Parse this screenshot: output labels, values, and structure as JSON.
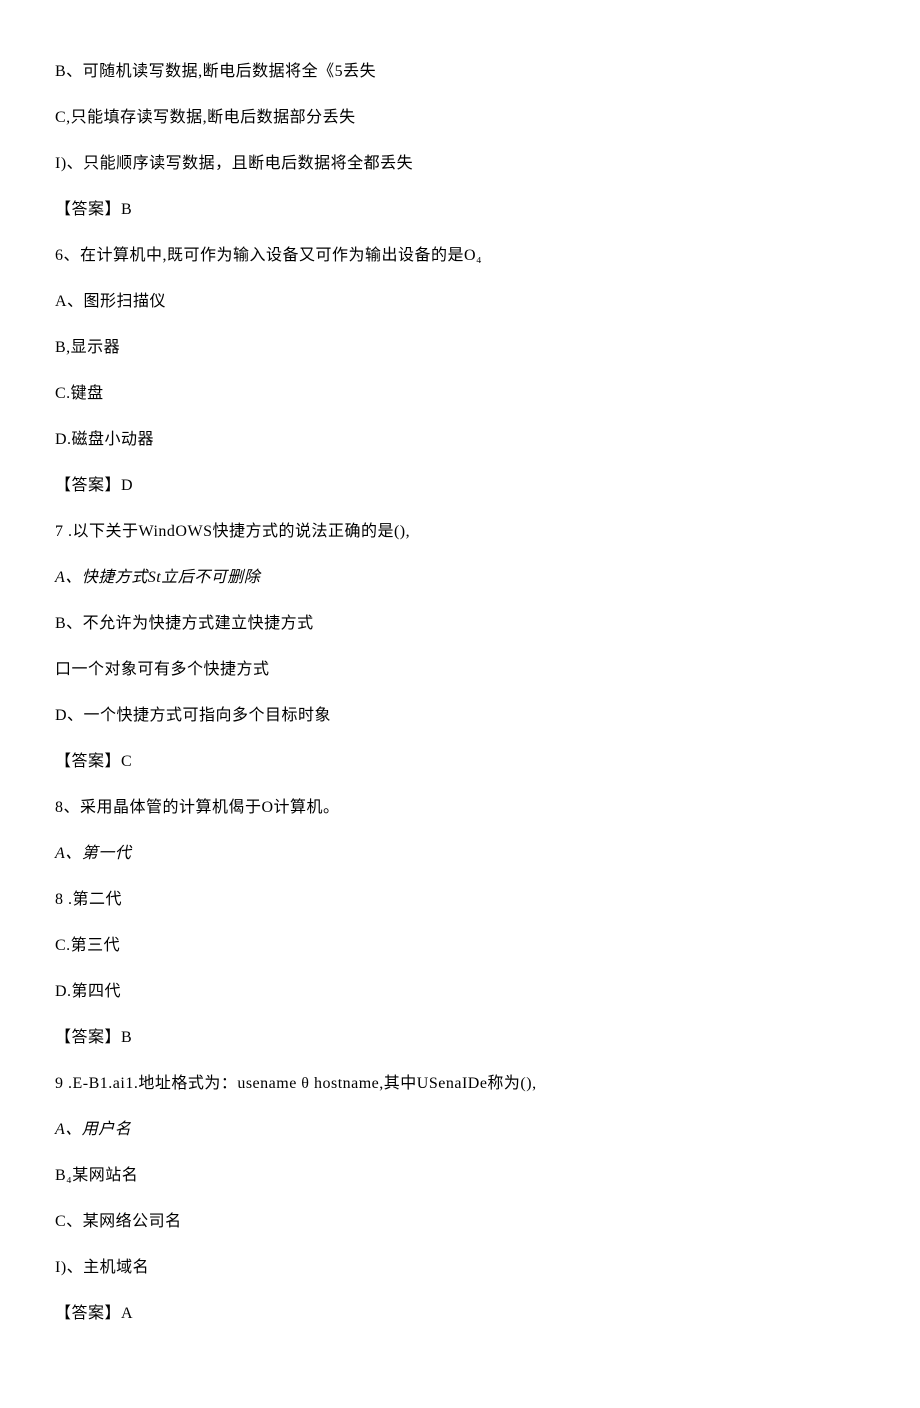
{
  "lines": [
    {
      "text": "B、可随机读写数据,断电后数据将全《5丢失"
    },
    {
      "text": "C,只能填存读写数据,断电后数据部分丢失"
    },
    {
      "text": "I)、只能顺序读写数据，且断电后数据将全都丢失"
    },
    {
      "text": "【答案】B"
    },
    {
      "text": "6、在计算机中,既可作为输入设备又可作为输出设备的是O₄"
    },
    {
      "text": "A、图形扫描仪"
    },
    {
      "text": "B,显示器"
    },
    {
      "text": "C.键盘"
    },
    {
      "text": "D.磁盘小动器"
    },
    {
      "text": "【答案】D"
    },
    {
      "text": "7 .以下关于WindOWS快捷方式的说法正确的是(),"
    },
    {
      "text": "A、快捷方式St立后不可删除",
      "italic": true
    },
    {
      "text": "B、不允许为快捷方式建立快捷方式"
    },
    {
      "text": "口一个对象可有多个快捷方式"
    },
    {
      "text": "D、一个快捷方式可指向多个目标时象"
    },
    {
      "text": "【答案】C"
    },
    {
      "text": "8、采用晶体管的计算机偈于O计算机。"
    },
    {
      "text": "A、第一代",
      "italic": true
    },
    {
      "text": "8 .第二代"
    },
    {
      "text": "C.第三代"
    },
    {
      "text": "D.第四代"
    },
    {
      "text": "【答案】B"
    },
    {
      "text": "9 .E-B1.ai1.地址格式为：usename θ hostname,其中USenaIDe称为(),"
    },
    {
      "text": "A、用户名",
      "italic": true
    },
    {
      "text": "B₄某网站名"
    },
    {
      "text": "C、某网络公司名"
    },
    {
      "text": "I)、主机域名"
    },
    {
      "text": "【答案】A"
    }
  ]
}
